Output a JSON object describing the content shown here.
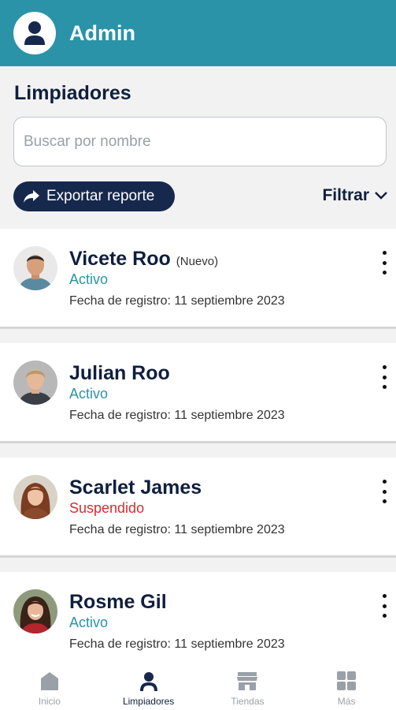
{
  "header": {
    "title": "Admin",
    "avatar_icon": "user-avatar-icon"
  },
  "section": {
    "title": "Limpiadores"
  },
  "search": {
    "placeholder": "Buscar por nombre",
    "value": ""
  },
  "actions": {
    "export_label": "Exportar reporte",
    "filter_label": "Filtrar"
  },
  "colors": {
    "header": "#2a93a8",
    "navy": "#17284d",
    "active": "#2a93a8",
    "suspended": "#d32f2f",
    "inactive_nav": "#9aa0a8"
  },
  "cleaners": [
    {
      "name": "Vicete Roo",
      "tag": "(Nuevo)",
      "status": "Activo",
      "status_type": "active",
      "date": "Fecha de registro: 11 septiembre 2023"
    },
    {
      "name": "Julian Roo",
      "tag": "",
      "status": "Activo",
      "status_type": "active",
      "date": "Fecha de registro: 11 septiembre 2023"
    },
    {
      "name": "Scarlet James",
      "tag": "",
      "status": "Suspendido",
      "status_type": "suspended",
      "date": "Fecha de registro: 11 septiembre 2023"
    },
    {
      "name": "Rosme Gil",
      "tag": "",
      "status": "Activo",
      "status_type": "active",
      "date": "Fecha de registro: 11 septiembre 2023"
    }
  ],
  "nav": [
    {
      "label": "Inicio",
      "icon": "home-icon",
      "active": false
    },
    {
      "label": "Limpiadores",
      "icon": "person-icon",
      "active": true
    },
    {
      "label": "Tiendas",
      "icon": "store-icon",
      "active": false
    },
    {
      "label": "Más",
      "icon": "grid-icon",
      "active": false
    }
  ]
}
